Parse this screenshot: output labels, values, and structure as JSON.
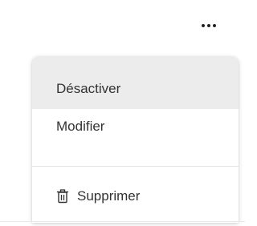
{
  "more_button": {
    "icon": "more-horizontal-icon"
  },
  "menu": {
    "items": [
      {
        "label": "Désactiver"
      },
      {
        "label": "Modifier"
      },
      {
        "label": "Supprimer",
        "icon": "trash-icon"
      }
    ]
  },
  "colors": {
    "hover_background": "#ececec",
    "text": "#333333",
    "divider": "#e4e4e4"
  }
}
